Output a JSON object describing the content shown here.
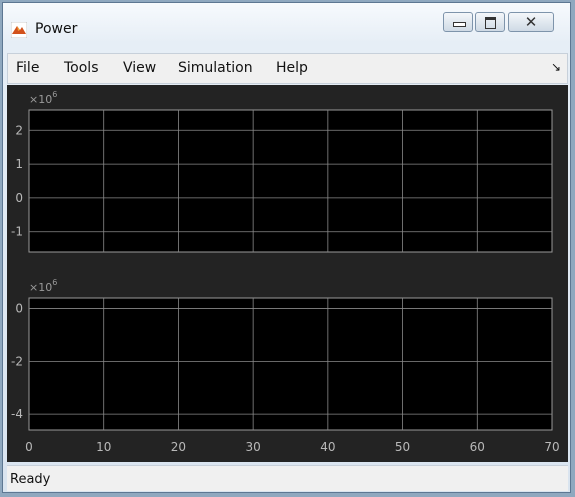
{
  "window": {
    "title": "Power",
    "icon": "matlab-icon",
    "controls": [
      "minimize",
      "maximize",
      "close"
    ],
    "close_glyph": "✕"
  },
  "menu": {
    "items": [
      "File",
      "Tools",
      "View",
      "Simulation",
      "Help"
    ],
    "toolbar_toggle_glyph": "↘"
  },
  "scope": {
    "background": "#000000",
    "figure_background": "#232323",
    "grid_color": "#8a8a8a",
    "x_ticks": [
      "0",
      "10",
      "20",
      "30",
      "40",
      "50",
      "60",
      "70"
    ],
    "axes": [
      {
        "exponent_label": "×10",
        "exponent_power": "6",
        "y_ticks": [
          "2",
          "1",
          "0",
          "-1"
        ]
      },
      {
        "exponent_label": "×10",
        "exponent_power": "6",
        "y_ticks": [
          "0",
          "-2",
          "-4"
        ]
      }
    ]
  },
  "chart_data": [
    {
      "type": "line",
      "x": [],
      "series": [],
      "xlim": [
        0,
        70
      ],
      "ylim": [
        -1.6,
        2.6
      ],
      "y_scale_exponent": 6,
      "grid": true
    },
    {
      "type": "line",
      "x": [],
      "series": [],
      "xlim": [
        0,
        70
      ],
      "ylim": [
        -4.6,
        0.4
      ],
      "y_scale_exponent": 6,
      "grid": true
    }
  ],
  "status": {
    "text": "Ready"
  }
}
